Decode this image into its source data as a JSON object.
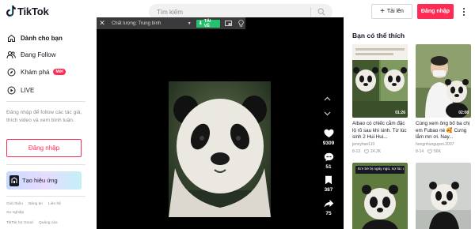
{
  "header": {
    "logo_text": "TikTok",
    "search_placeholder": "Tìm kiếm",
    "upload_label": "Tải lên",
    "login_label": "Đăng nhập"
  },
  "sidebar": {
    "items": [
      {
        "label": "Dành cho bạn",
        "icon": "home-icon"
      },
      {
        "label": "Đang Follow",
        "icon": "following-icon"
      },
      {
        "label": "Khám phá",
        "icon": "compass-icon",
        "badge": "Mới"
      },
      {
        "label": "LIVE",
        "icon": "live-icon"
      }
    ],
    "login_prompt": "Đăng nhập để follow các tác giả, thích video và xem bình luận.",
    "login_button": "Đăng nhập",
    "effects_button": "Tạo hiệu ứng",
    "footer_row1": [
      "Giới thiệu",
      "Bảng tin",
      "Liên hệ"
    ],
    "footer_row2": [
      "Sự nghiệp"
    ],
    "footer_row3": [
      "TikTok for Good",
      "Quảng cáo"
    ]
  },
  "player": {
    "quality_label": "Chất lượng: Trung bình",
    "download_label": "TẢI VỀ",
    "likes": "9309",
    "comments": "51",
    "saves": "387",
    "shares": "75"
  },
  "suggestions": {
    "title": "Bạn có thể thích",
    "cards": [
      {
        "duration": "01:26",
        "title": "Aibao có chiếc cằm đặc lộ rõ sau khi sinh. Từ lúc sinh 2 Hui Hui...",
        "author": "jennyhan110",
        "likes": "8-13",
        "views": "24.2K"
      },
      {
        "duration": "02:08",
        "title": "Cùng xem ông bố ba chị em Fubao nè 🥰 Cưng lắm mn ơi. Nay...",
        "author": "hongnhunguyen.2007",
        "likes": "8-14",
        "views": "56K"
      },
      {
        "overlay": "Em bé bị ngáy ngủ, sợ lúc điều"
      },
      {}
    ]
  },
  "colors": {
    "brand_red": "#fe2c55",
    "download_green": "#25c26e",
    "text_primary": "#161823",
    "text_muted": "#8a8b91"
  }
}
